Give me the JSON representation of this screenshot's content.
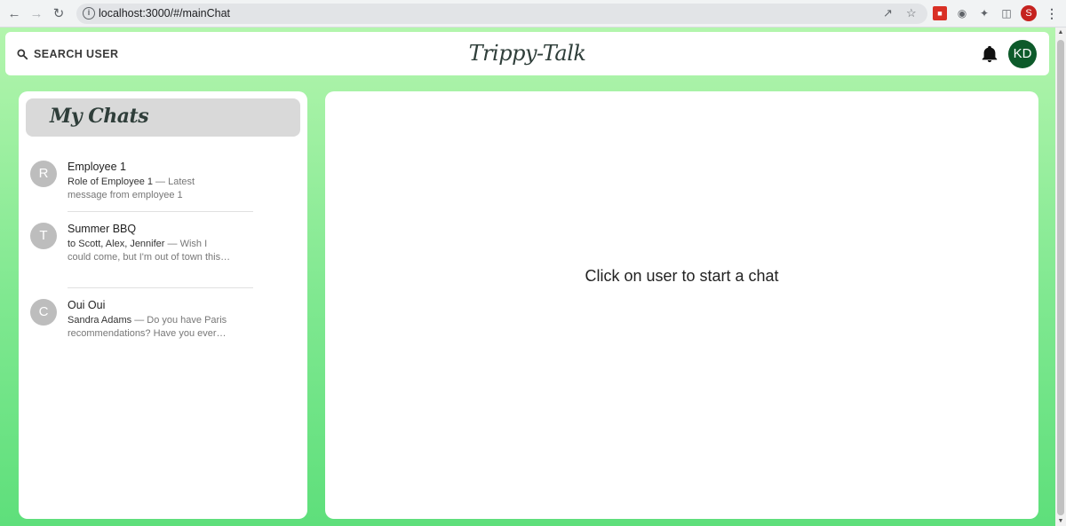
{
  "browser": {
    "url": "localhost:3000/#/mainChat",
    "profile_initial": "S"
  },
  "topbar": {
    "search_label": "SEARCH USER",
    "brand": "Trippy-Talk",
    "user_initials": "KD"
  },
  "chats": {
    "title": "My Chats",
    "items": [
      {
        "initial": "R",
        "name": "Employee 1",
        "sender": "Role of Employee 1",
        "preview": " — Latest message from employee 1"
      },
      {
        "initial": "T",
        "name": "Summer BBQ",
        "sender": "to Scott, Alex, Jennifer",
        "preview": " — Wish I could come, but I'm out of town this…"
      },
      {
        "initial": "C",
        "name": "Oui Oui",
        "sender": "Sandra Adams",
        "preview": " — Do you have Paris recommendations? Have you ever…"
      }
    ]
  },
  "main": {
    "empty_message": "Click on user to start a chat"
  },
  "colors": {
    "avatar_bg": "#0d5a2a",
    "gradient_top": "#b3f5ad",
    "gradient_bottom": "#5edf7b"
  }
}
